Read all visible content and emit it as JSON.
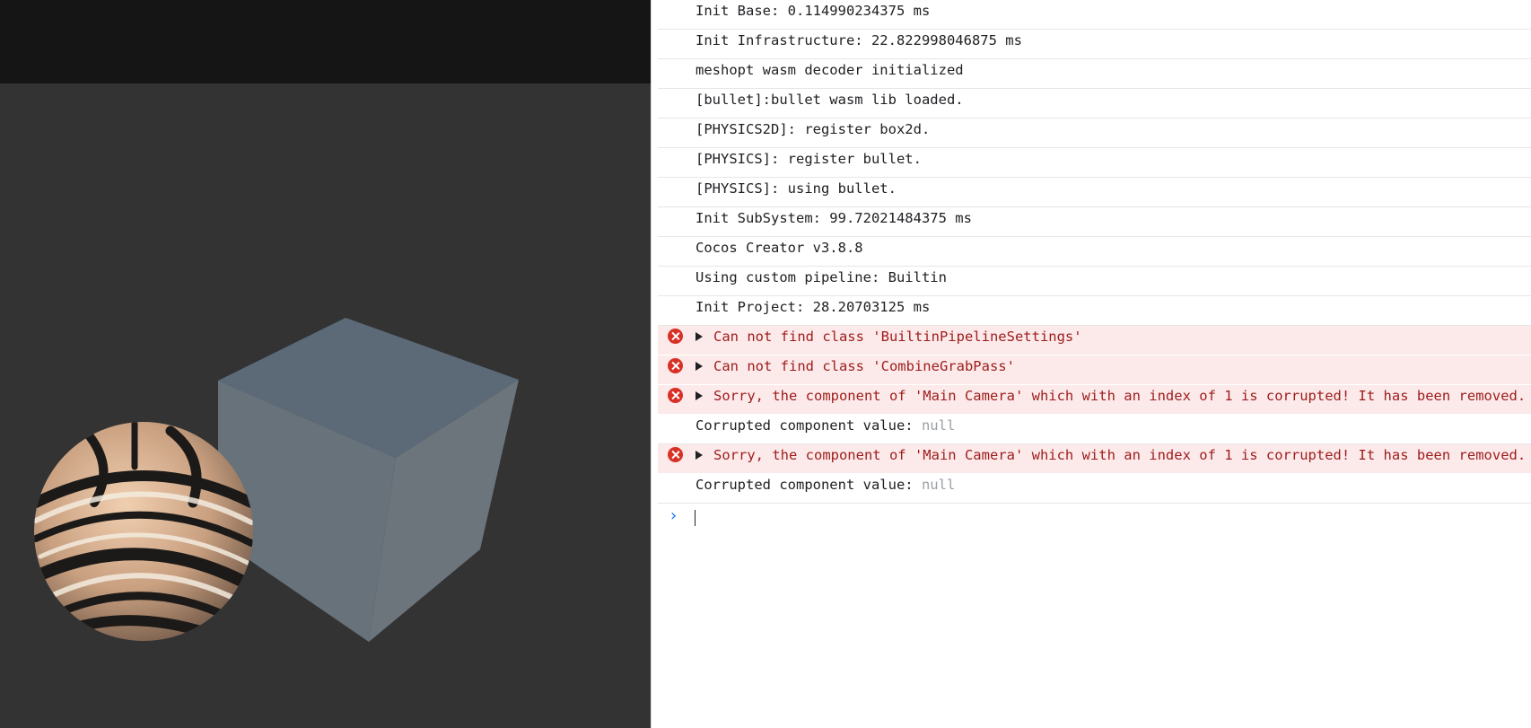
{
  "colors": {
    "viewport_bg": "#333333",
    "topbar_bg": "#151515",
    "error_bg": "#fceaea",
    "error_icon": "#d93025",
    "prompt_chevron": "#1a73e8"
  },
  "scene": {
    "objects": [
      "textured-sphere",
      "gray-cube"
    ]
  },
  "console": {
    "rows": [
      {
        "type": "log",
        "text": "Init Base: 0.114990234375 ms"
      },
      {
        "type": "log",
        "text": "Init Infrastructure: 22.822998046875 ms"
      },
      {
        "type": "log",
        "text": "meshopt wasm decoder initialized"
      },
      {
        "type": "log",
        "text": "[bullet]:bullet wasm lib loaded."
      },
      {
        "type": "log",
        "text": "[PHYSICS2D]: register box2d."
      },
      {
        "type": "log",
        "text": "[PHYSICS]: register bullet."
      },
      {
        "type": "log",
        "text": "[PHYSICS]: using bullet."
      },
      {
        "type": "log",
        "text": "Init SubSystem: 99.72021484375 ms"
      },
      {
        "type": "log",
        "text": "Cocos Creator v3.8.8"
      },
      {
        "type": "log",
        "text": "Using custom pipeline: Builtin"
      },
      {
        "type": "log",
        "text": "Init Project: 28.20703125 ms"
      },
      {
        "type": "error",
        "text": "Can not find class 'BuiltinPipelineSettings'"
      },
      {
        "type": "error",
        "text": "Can not find class 'CombineGrabPass'"
      },
      {
        "type": "error",
        "text": "Sorry, the component of 'Main Camera' which with an index of 1 is corrupted! It has been removed."
      },
      {
        "type": "log",
        "text": "Corrupted component value: ",
        "value": "null"
      },
      {
        "type": "error",
        "text": "Sorry, the component of 'Main Camera' which with an index of 1 is corrupted! It has been removed."
      },
      {
        "type": "log",
        "text": "Corrupted component value: ",
        "value": "null"
      }
    ],
    "prompt_symbol": "›"
  }
}
